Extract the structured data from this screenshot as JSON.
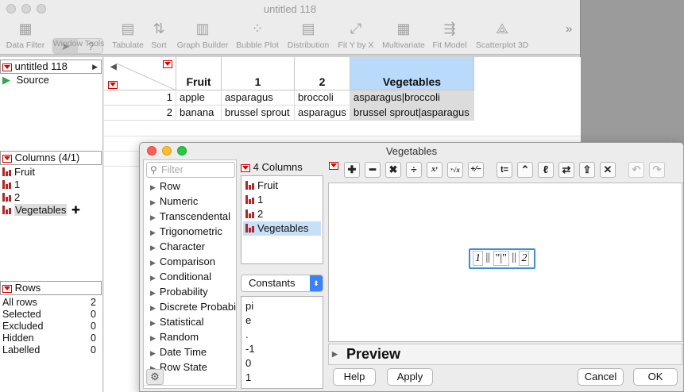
{
  "main_window": {
    "title": "untitled 118",
    "toolbar": {
      "items": [
        {
          "label": "Data Filter",
          "icon": "data-filter-icon",
          "glyph": "▦"
        },
        {
          "label": "Tabulate",
          "icon": "tabulate-icon",
          "glyph": "▤"
        },
        {
          "label": "Sort",
          "icon": "sort-icon",
          "glyph": "⇅"
        },
        {
          "label": "Graph Builder",
          "icon": "graph-builder-icon",
          "glyph": "▥"
        },
        {
          "label": "Bubble Plot",
          "icon": "bubble-plot-icon",
          "glyph": "⁘"
        },
        {
          "label": "Distribution",
          "icon": "distribution-icon",
          "glyph": "▤"
        },
        {
          "label": "Fit Y by X",
          "icon": "fit-y-by-x-icon",
          "glyph": "⤢"
        },
        {
          "label": "Multivariate",
          "icon": "multivariate-icon",
          "glyph": "▦"
        },
        {
          "label": "Fit Model",
          "icon": "fit-model-icon",
          "glyph": "⇶"
        },
        {
          "label": "Scatterplot 3D",
          "icon": "scatterplot-3d-icon",
          "glyph": "⟁"
        }
      ],
      "window_tools_label": "Window Tools",
      "arrow_glyph": "➤",
      "help_glyph": "?",
      "overflow_glyph": "»"
    },
    "table_panel": {
      "name": "untitled 118",
      "expand_glyph": "▶",
      "script": "Source",
      "script_glyph": "▶"
    },
    "columns_panel": {
      "header": "Columns (4/1)",
      "items": [
        "Fruit",
        "1",
        "2",
        "Vegetables"
      ],
      "add_glyph": "✚"
    },
    "rows_panel": {
      "header": "Rows",
      "stats": [
        {
          "label": "All rows",
          "value": "2"
        },
        {
          "label": "Selected",
          "value": "0"
        },
        {
          "label": "Excluded",
          "value": "0"
        },
        {
          "label": "Hidden",
          "value": "0"
        },
        {
          "label": "Labelled",
          "value": "0"
        }
      ]
    },
    "grid": {
      "corner_glyph": "◀",
      "columns": [
        "Fruit",
        "1",
        "2",
        "Vegetables"
      ],
      "rows": [
        {
          "num": "1",
          "cells": [
            "apple",
            "asparagus",
            "broccoli",
            "asparagus|broccoli"
          ]
        },
        {
          "num": "2",
          "cells": [
            "banana",
            "brussel sprout",
            "asparagus",
            "brussel sprout|asparagus"
          ]
        }
      ]
    }
  },
  "formula_editor": {
    "title": "Vegetables",
    "filter_placeholder": "Filter",
    "search_glyph": "⚲",
    "functions": [
      "Row",
      "Numeric",
      "Transcendental",
      "Trigonometric",
      "Character",
      "Comparison",
      "Conditional",
      "Probability",
      "Discrete Probability",
      "Statistical",
      "Random",
      "Date Time",
      "Row State"
    ],
    "columns_header": "4 Columns",
    "columns": [
      "Fruit",
      "1",
      "2",
      "Vegetables"
    ],
    "constants_select": "Constants",
    "select_glyph": "⬍",
    "constants": [
      "pi",
      "e",
      ".",
      "-1",
      "0",
      "1"
    ],
    "buttons": [
      {
        "name": "add-button",
        "glyph": "✚"
      },
      {
        "name": "subtract-button",
        "glyph": "━"
      },
      {
        "name": "multiply-button",
        "glyph": "✖"
      },
      {
        "name": "divide-button",
        "glyph": "÷"
      },
      {
        "name": "power-button",
        "glyph": "xʸ"
      },
      {
        "name": "root-button",
        "glyph": "ʸ√x"
      },
      {
        "name": "negate-button",
        "glyph": "+⁄−"
      },
      {
        "name": "assign-button",
        "glyph": "t="
      },
      {
        "name": "peel-button",
        "glyph": "⌃"
      },
      {
        "name": "local-variable-button",
        "glyph": "ℓ"
      },
      {
        "name": "swap-button",
        "glyph": "⇄"
      },
      {
        "name": "unthread-button",
        "glyph": "⇪"
      },
      {
        "name": "delete-button",
        "glyph": "✕"
      }
    ],
    "undo_glyph": "↶",
    "redo_glyph": "↷",
    "formula": {
      "arg1": "1",
      "sep1": "||",
      "literal": "\"|\"",
      "sep2": "||",
      "arg2": "2"
    },
    "preview_label": "Preview",
    "preview_glyph": "▶",
    "help_label": "Help",
    "apply_label": "Apply",
    "cancel_label": "Cancel",
    "ok_label": "OK",
    "gear_glyph": "⚙"
  }
}
